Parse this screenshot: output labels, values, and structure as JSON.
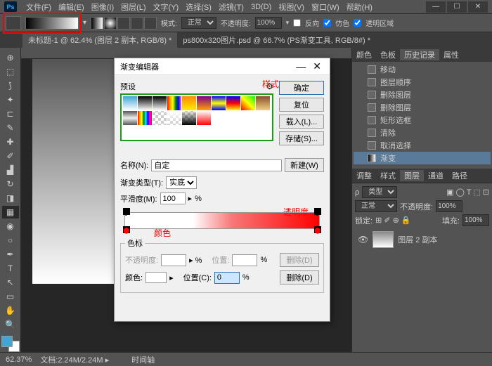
{
  "menu": [
    "文件(F)",
    "编辑(E)",
    "图像(I)",
    "图层(L)",
    "文字(Y)",
    "选择(S)",
    "滤镜(T)",
    "3D(D)",
    "视图(V)",
    "窗口(W)",
    "帮助(H)"
  ],
  "options": {
    "mode_label": "模式:",
    "mode": "正常",
    "opacity_label": "不透明度:",
    "opacity": "100%",
    "reverse": "反向",
    "dither": "仿色",
    "transparency": "透明区域"
  },
  "tabs": [
    "未标题-1 @ 62.4% (图层 2 副本, RGB/8) *",
    "ps800x320图片.psd @ 66.7% (PS渐变工具, RGB/8#) *"
  ],
  "panels": {
    "color_tabs": [
      "颜色",
      "色板",
      "历史记录",
      "属性"
    ],
    "history": [
      "移动",
      "图层顺序",
      "删除图层",
      "删除图层",
      "矩形选框",
      "清除",
      "取消选择",
      "渐变"
    ],
    "layer_tabs": [
      "调整",
      "样式",
      "图层",
      "通道",
      "路径"
    ],
    "kind": "类型",
    "blend": "正常",
    "opacity_label": "不透明度:",
    "opacity": "100%",
    "lock": "锁定:",
    "fill_label": "填充:",
    "fill": "100%",
    "layer_name": "图层 2 副本"
  },
  "status": {
    "zoom": "62.37%",
    "doc_label": "文档:",
    "doc": "2.24M/2.24M",
    "timeline": "时间轴"
  },
  "dialog": {
    "title": "渐变编辑器",
    "presets": "预设",
    "style_anno": "样式",
    "ok": "确定",
    "cancel": "复位",
    "load": "载入(L)...",
    "save": "存储(S)...",
    "name_label": "名称(N):",
    "name": "自定",
    "new_btn": "新建(W)",
    "grad_type_label": "渐变类型(T):",
    "grad_type": "实底",
    "smooth_label": "平滑度(M):",
    "smooth": "100",
    "pct": "%",
    "opacity_anno": "透明度",
    "color_anno": "颜色",
    "stops_legend": "色标",
    "stop_opacity": "不透明度:",
    "stop_pos1": "位置:",
    "del1": "删除(D)",
    "stop_color": "颜色:",
    "stop_pos2": "位置(C):",
    "pos_val": "0",
    "del2": "删除(D)"
  }
}
